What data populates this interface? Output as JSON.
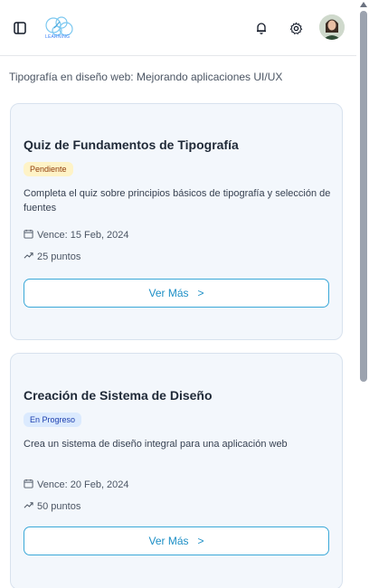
{
  "header": {
    "logo_text": "LEARNING",
    "icons": [
      "sidebar-toggle-icon",
      "bell-icon",
      "gear-icon",
      "avatar"
    ]
  },
  "page": {
    "heading": "Tipografía en diseño web: Mejorando aplicaciones UI/UX"
  },
  "cards": [
    {
      "title": "Quiz de Fundamentos de Tipografía",
      "status": "Pendiente",
      "status_color": "#fef3c7",
      "description": "Completa el quiz sobre principios básicos de tipografía y selección de fuentes",
      "due": "Vence: 15 Feb, 2024",
      "points": "25 puntos",
      "button_label": "Ver Más",
      "button_arrow": ">"
    },
    {
      "title": "Creación de Sistema de Diseño",
      "status": "En Progreso",
      "status_color": "#dbeafe",
      "description": "Crea un sistema de diseño integral para una aplicación web",
      "due": "Vence: 20 Feb, 2024",
      "points": "50 puntos",
      "button_label": "Ver Más",
      "button_arrow": ">"
    }
  ],
  "colors": {
    "accent": "#1d8fc6",
    "card_bg": "#f3f7fc",
    "card_border": "#d8e2ee"
  }
}
